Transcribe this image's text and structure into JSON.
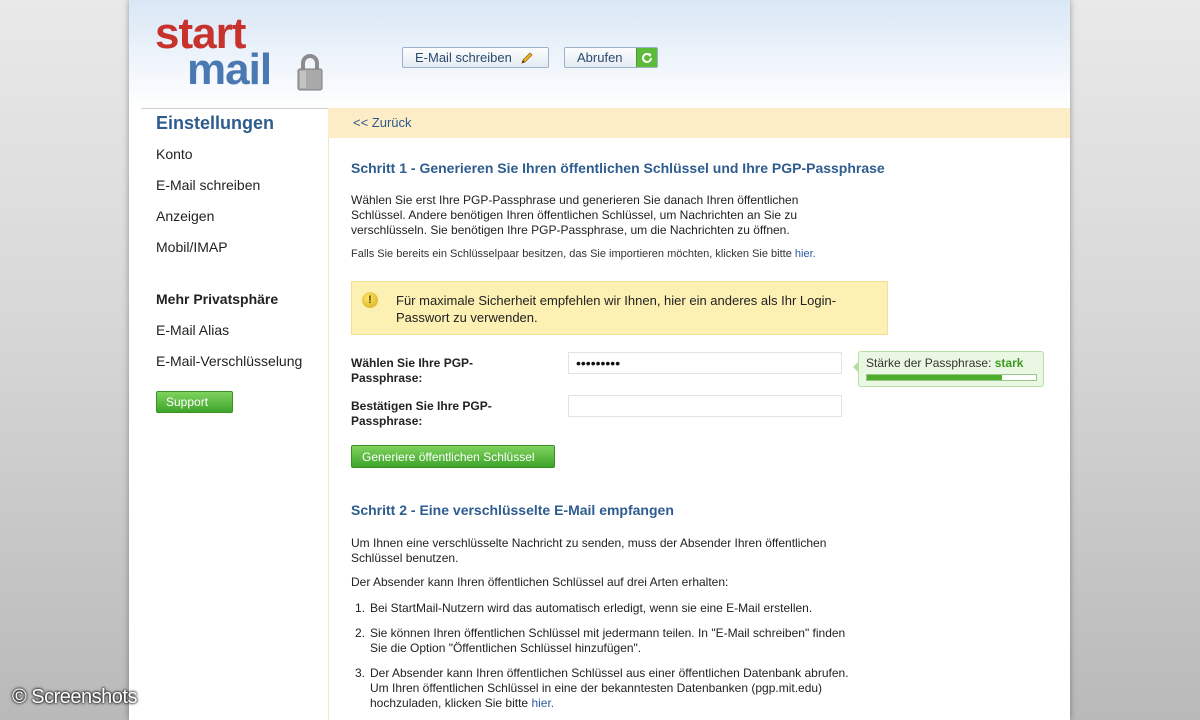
{
  "header": {
    "logo_word1": "start",
    "logo_word2": "mail",
    "compose_label": "E-Mail schreiben",
    "fetch_label": "Abrufen"
  },
  "sidebar": {
    "title": "Einstellungen",
    "items": [
      "Konto",
      "E-Mail schreiben",
      "Anzeigen",
      "Mobil/IMAP"
    ],
    "section_title": "Mehr Privatsphäre",
    "section_items": [
      "E-Mail Alias",
      "E-Mail-Verschlüsselung"
    ],
    "support_label": "Support"
  },
  "backbar": {
    "back_label": "<< Zurück"
  },
  "step1": {
    "heading": "Schritt 1 - Generieren Sie Ihren öffentlichen Schlüssel und Ihre PGP-Passphrase",
    "para": "Wählen Sie erst Ihre PGP-Passphrase und generieren Sie danach Ihren öffentlichen Schlüssel. Andere benötigen Ihren öffentlichen Schlüssel, um Nachrichten an Sie zu verschlüsseln. Sie benötigen Ihre PGP-Passphrase, um die Nachrichten zu öffnen.",
    "import_note": "Falls Sie bereits ein Schlüsselpaar besitzen, das Sie importieren möchten, klicken Sie bitte",
    "import_link": "hier.",
    "warning": "Für maximale Sicherheit empfehlen wir Ihnen, hier ein anderes als Ihr Login-Passwort zu verwenden.",
    "label_choose": "Wählen Sie Ihre PGP-Passphrase:",
    "passphrase_value": "•••••••••",
    "label_confirm": "Bestätigen Sie Ihre PGP-Passphrase:",
    "confirm_value": "",
    "strength_label": "Stärke der Passphrase:",
    "strength_value": "stark",
    "strength_level": 0.8,
    "generate_label": "Generiere öffentlichen Schlüssel"
  },
  "step2": {
    "heading": "Schritt 2 - Eine verschlüsselte E-Mail empfangen",
    "para1": "Um Ihnen eine verschlüsselte Nachricht zu senden, muss der Absender Ihren öffentlichen Schlüssel benutzen.",
    "para2": "Der Absender kann Ihren öffentlichen Schlüssel auf drei Arten erhalten:",
    "list": [
      "Bei StartMail-Nutzern wird das automatisch erledigt, wenn sie eine E-Mail erstellen.",
      "Sie können Ihren öffentlichen Schlüssel mit jedermann teilen. In \"E-Mail schreiben\" finden Sie die Option \"Öffentlichen Schlüssel hinzufügen\".",
      "Der Absender kann Ihren öffentlichen Schlüssel aus einer öffentlichen Datenbank abrufen. Um Ihren öffentlichen Schlüssel in eine der bekanntesten Datenbanken (pgp.mit.edu) hochzuladen, klicken Sie bitte"
    ],
    "list_link": "hier."
  },
  "watermark": "© Screenshots",
  "colors": {
    "heading_blue": "#2e5c8e",
    "logo_red": "#c8322c",
    "logo_blue": "#4a78b3",
    "backbar_bg": "#fcedc7",
    "warning_bg": "#fcf0b2",
    "button_green": "#3ea52a"
  },
  "icons": [
    "pencil-icon",
    "refresh-icon",
    "lock-icon",
    "warning-icon"
  ]
}
